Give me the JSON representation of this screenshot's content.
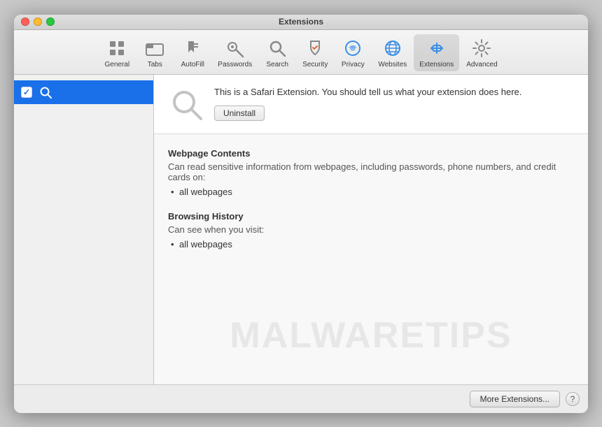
{
  "window": {
    "title": "Extensions"
  },
  "toolbar": {
    "items": [
      {
        "id": "general",
        "label": "General",
        "icon": "general"
      },
      {
        "id": "tabs",
        "label": "Tabs",
        "icon": "tabs"
      },
      {
        "id": "autofill",
        "label": "AutoFill",
        "icon": "autofill"
      },
      {
        "id": "passwords",
        "label": "Passwords",
        "icon": "passwords"
      },
      {
        "id": "search",
        "label": "Search",
        "icon": "search"
      },
      {
        "id": "security",
        "label": "Security",
        "icon": "security"
      },
      {
        "id": "privacy",
        "label": "Privacy",
        "icon": "privacy"
      },
      {
        "id": "websites",
        "label": "Websites",
        "icon": "websites"
      },
      {
        "id": "extensions",
        "label": "Extensions",
        "icon": "extensions",
        "active": true
      },
      {
        "id": "advanced",
        "label": "Advanced",
        "icon": "advanced"
      }
    ]
  },
  "sidebar": {
    "items": [
      {
        "id": "search-ext",
        "label": "",
        "checked": true,
        "selected": true
      }
    ]
  },
  "extension": {
    "description": "This is a Safari Extension. You should tell us what your extension does here.",
    "uninstall_label": "Uninstall"
  },
  "permissions": {
    "sections": [
      {
        "id": "webpage-contents",
        "title": "Webpage Contents",
        "description": "Can read sensitive information from webpages, including passwords, phone numbers, and credit cards on:",
        "items": [
          "all webpages"
        ]
      },
      {
        "id": "browsing-history",
        "title": "Browsing History",
        "description": "Can see when you visit:",
        "items": [
          "all webpages"
        ]
      }
    ]
  },
  "footer": {
    "more_extensions_label": "More Extensions...",
    "help_label": "?"
  },
  "watermark": {
    "text": "MALWARETIPS"
  }
}
